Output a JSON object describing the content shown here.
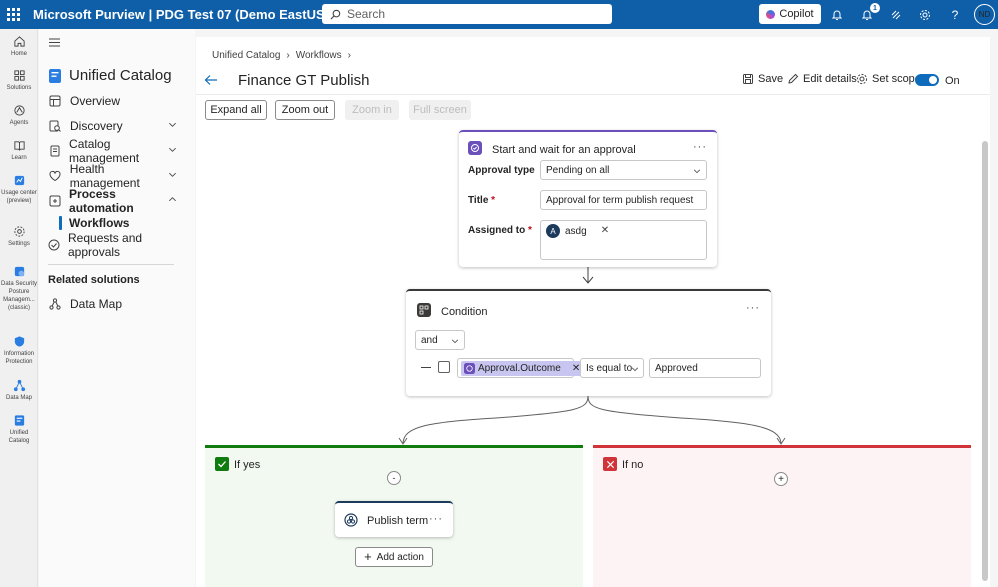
{
  "topbar": {
    "title": "Microsoft Purview | PDG Test 07 (Demo EastUS)",
    "search_placeholder": "Search",
    "copilot_label": "Copilot",
    "notification_count": "1",
    "user_initials": "ND",
    "bg_color": "#0f5ea8"
  },
  "rail": {
    "home": "Home",
    "solutions": "Solutions",
    "agents": "Agents",
    "learn": "Learn",
    "usage": "Usage center (preview)",
    "settings": "Settings",
    "dspm": "Data Security Posture Managem... (classic)",
    "info_protection": "Information Protection",
    "data_map": "Data Map",
    "unified_catalog": "Unified Catalog"
  },
  "sidenav": {
    "title": "Unified Catalog",
    "items": {
      "overview": "Overview",
      "discovery": "Discovery",
      "catalog_management": "Catalog management",
      "health_management": "Health management",
      "process_automation": "Process automation",
      "workflows": "Workflows",
      "requests": "Requests and approvals"
    },
    "related_heading": "Related solutions",
    "related_data_map": "Data Map"
  },
  "breadcrumb": {
    "item1": "Unified Catalog",
    "item2": "Workflows"
  },
  "page": {
    "title": "Finance GT Publish",
    "save_label": "Save",
    "edit_details_label": "Edit details",
    "set_scope_label": "Set scope",
    "toggle_label": "On"
  },
  "canvas_toolbar": {
    "expand_all": "Expand all",
    "zoom_out": "Zoom out",
    "zoom_in": "Zoom in",
    "full_screen": "Full screen"
  },
  "approval_card": {
    "title": "Start and wait for an approval",
    "approval_type_label": "Approval type",
    "approval_type_value": "Pending on all",
    "title_label": "Title",
    "title_value": "Approval for term publish request",
    "assigned_label": "Assigned to",
    "assignee_initial": "A",
    "assignee_name": "asdg",
    "required_mark": "*"
  },
  "condition_card": {
    "title": "Condition",
    "operator": "and",
    "dynamic_value": "Approval.Outcome",
    "comparison": "Is equal to",
    "compare_value": "Approved"
  },
  "if_yes": {
    "label": "If yes",
    "collapse_symbol": "-",
    "action_title": "Publish term",
    "add_action_label": "Add action",
    "accent": "#107c10"
  },
  "if_no": {
    "label": "If no",
    "add_symbol": "+",
    "accent": "#d13438"
  }
}
